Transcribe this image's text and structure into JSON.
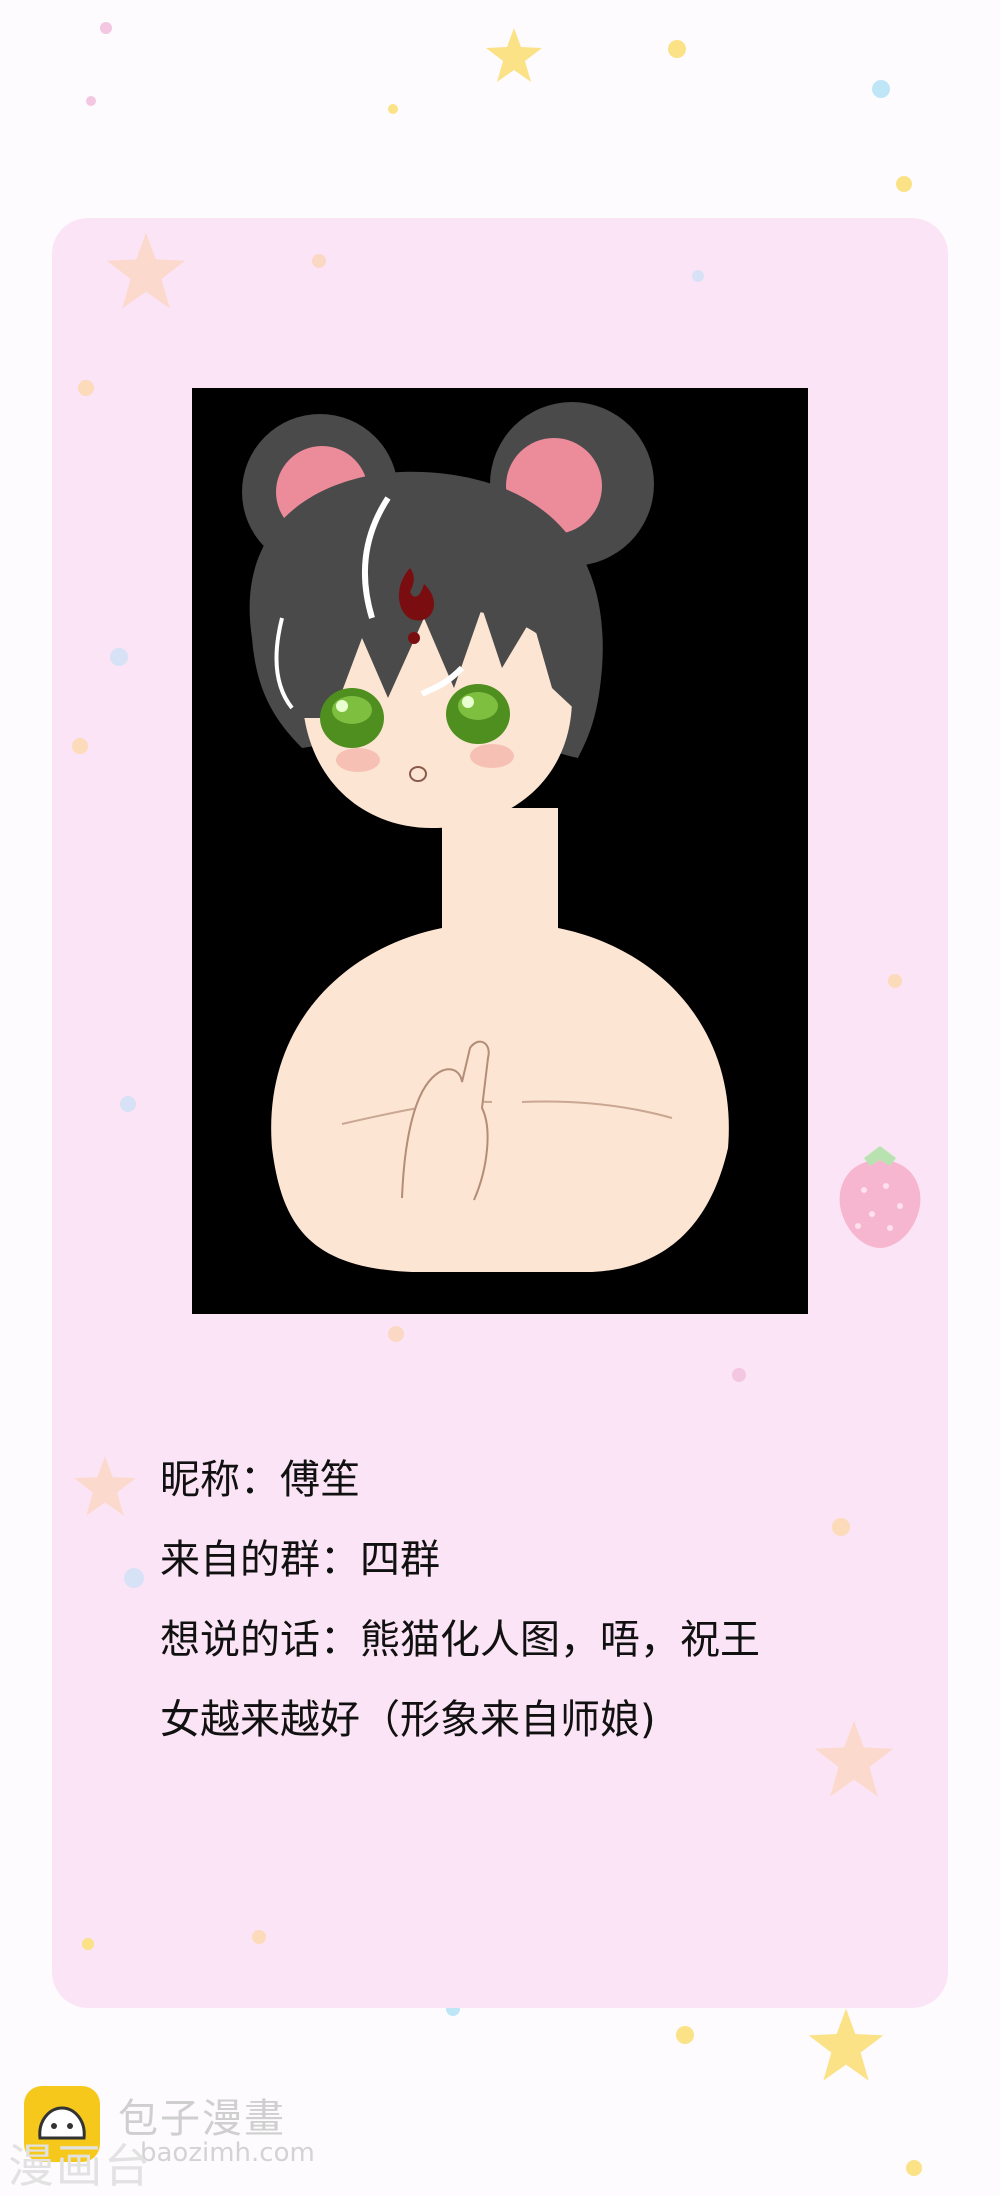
{
  "profile": {
    "nickname_line": "昵称：傅笙",
    "group_line": "来自的群：四群",
    "message_line_1": "想说的话：熊猫化人图，唔，祝王",
    "message_line_2": "女越来越好（形象来自师娘)"
  },
  "watermark": {
    "brand": "包子漫畫",
    "url": "baozimh.com",
    "side_text": "漫画台"
  },
  "colors": {
    "card_background": "#fbe4f5",
    "page_background": "#fdfbfd",
    "frame_background": "#000000",
    "hair": "#4a4a4a",
    "ear_inner": "#ec8b9a",
    "eyes": "#4f8f1f",
    "forehead_mark": "#7a0d10",
    "skin": "#fde5d3",
    "logo": "#f6c81c"
  }
}
